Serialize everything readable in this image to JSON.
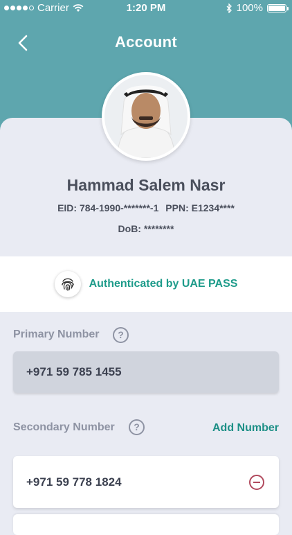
{
  "status_bar": {
    "carrier": "Carrier",
    "time": "1:20 PM",
    "battery": "100%"
  },
  "header": {
    "title": "Account"
  },
  "profile": {
    "name": "Hammad Salem Nasr",
    "eid": "EID: 784-1990-*******-1",
    "ppn": "PPN: E1234****",
    "dob": "DoB: ********"
  },
  "auth": {
    "text": "Authenticated by UAE PASS"
  },
  "primary": {
    "label": "Primary Number",
    "number": "+971 59 785 1455"
  },
  "secondary": {
    "label": "Secondary Number",
    "add_label": "Add Number",
    "number": "+971 59 778 1824"
  },
  "colors": {
    "header": "#5ea6ae",
    "accent": "#1d9b8a",
    "remove": "#b14a5e"
  }
}
